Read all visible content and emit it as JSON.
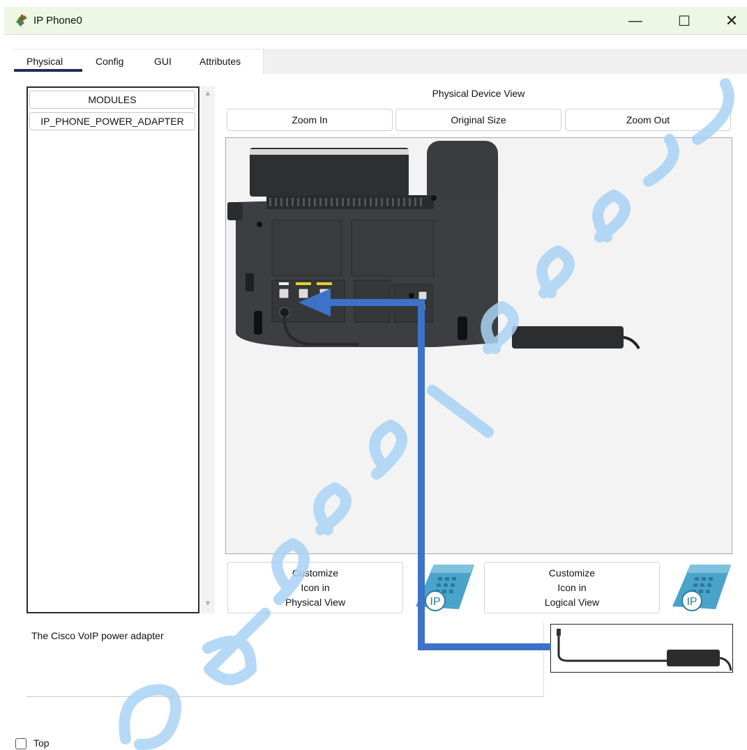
{
  "window": {
    "title": "IP Phone0",
    "minimize_glyph": "—",
    "maximize_glyph": "☐",
    "close_glyph": "✕",
    "icon": "cisco-phone-icon"
  },
  "tabs": [
    {
      "label": "Physical",
      "active": true
    },
    {
      "label": "Config",
      "active": false
    },
    {
      "label": "GUI",
      "active": false
    },
    {
      "label": "Attributes",
      "active": false
    }
  ],
  "modules": {
    "header": "MODULES",
    "items": [
      "IP_PHONE_POWER_ADAPTER"
    ]
  },
  "physical_view": {
    "title": "Physical Device View",
    "zoom_in": "Zoom In",
    "original_size": "Original Size",
    "zoom_out": "Zoom Out"
  },
  "customize": {
    "physical": {
      "line1": "Customize",
      "line2": "Icon in",
      "line3": "Physical View"
    },
    "logical": {
      "line1": "Customize",
      "line2": "Icon in",
      "line3": "Logical View"
    },
    "ip_label": "IP"
  },
  "description": "The Cisco VoIP power adapter",
  "footer": {
    "top_label": "Top",
    "top_checked": false
  },
  "colors": {
    "titlebar_bg": "#eef7e4",
    "tab_underline": "#1f2d55",
    "arrow": "#3d72c8",
    "watermark": "#a9d2f5",
    "phone_body": "#3c3e41",
    "ip_icon": "#4aa3c9"
  }
}
